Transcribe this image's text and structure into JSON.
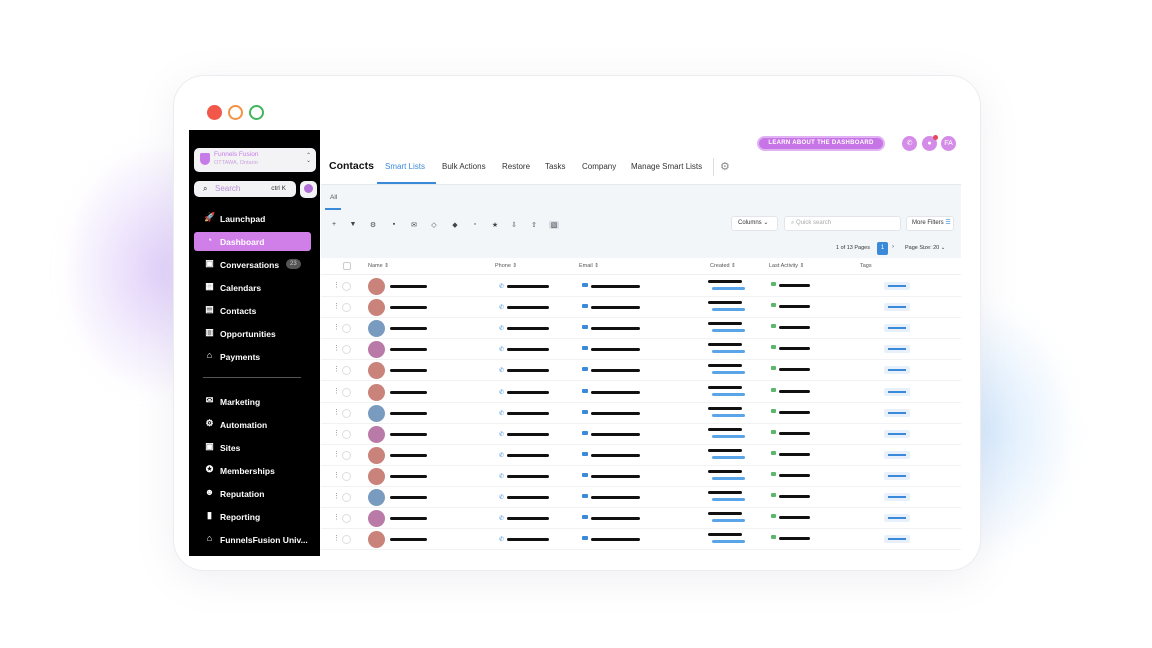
{
  "sidebar": {
    "account_name": "Funnels Fusion",
    "account_location": "OTTAWA, Ontario",
    "search_placeholder": "Search",
    "search_shortcut": "ctrl K",
    "items_top": [
      {
        "label": "Launchpad",
        "icon": "rocket-icon",
        "glyph": "🚀"
      },
      {
        "label": "Dashboard",
        "icon": "dashboard-icon",
        "glyph": "◔",
        "active": true
      },
      {
        "label": "Conversations",
        "icon": "chat-icon",
        "glyph": "▣",
        "badge": "23"
      },
      {
        "label": "Calendars",
        "icon": "calendar-icon",
        "glyph": "▦"
      },
      {
        "label": "Contacts",
        "icon": "contacts-icon",
        "glyph": "▤"
      },
      {
        "label": "Opportunities",
        "icon": "opportunities-icon",
        "glyph": "▥"
      },
      {
        "label": "Payments",
        "icon": "payments-icon",
        "glyph": "⌂"
      }
    ],
    "items_bottom": [
      {
        "label": "Marketing",
        "icon": "marketing-icon",
        "glyph": "✉"
      },
      {
        "label": "Automation",
        "icon": "automation-icon",
        "glyph": "⚙"
      },
      {
        "label": "Sites",
        "icon": "sites-icon",
        "glyph": "▣"
      },
      {
        "label": "Memberships",
        "icon": "memberships-icon",
        "glyph": "✪"
      },
      {
        "label": "Reputation",
        "icon": "reputation-icon",
        "glyph": "☻"
      },
      {
        "label": "Reporting",
        "icon": "reporting-icon",
        "glyph": "▮"
      },
      {
        "label": "FunnelsFusion Univ...",
        "icon": "university-icon",
        "glyph": "⌂"
      }
    ]
  },
  "header": {
    "learn_label": "LEARN ABOUT THE DASHBOARD",
    "avatar_initials": "FA"
  },
  "tabs": {
    "title": "Contacts",
    "items": [
      "Smart Lists",
      "Bulk Actions",
      "Restore",
      "Tasks",
      "Company",
      "Manage Smart Lists"
    ],
    "active": "Smart Lists"
  },
  "subtab": "All",
  "toolbar": {
    "columns_label": "Columns",
    "search_placeholder": "Quick search",
    "more_filters_label": "More Filters"
  },
  "pager": {
    "info": "1 of 13 Pages",
    "current_page": "1",
    "page_size": "Page Size: 20"
  },
  "table": {
    "headers": [
      "Name",
      "Phone",
      "Email",
      "Created",
      "Last Activity",
      "Tags"
    ],
    "avatar_colors": [
      "#c9837b",
      "#c9837b",
      "#7a9bc0",
      "#b97aa8",
      "#c9837b",
      "#c9837b",
      "#7a9bc0",
      "#b97aa8",
      "#c9837b",
      "#c9837b",
      "#7a9bc0",
      "#b97aa8",
      "#c9837b"
    ]
  },
  "colors": {
    "accent": "#d07ee8",
    "primary_blue": "#3b8ad9",
    "sidebar_bg": "#000000"
  }
}
